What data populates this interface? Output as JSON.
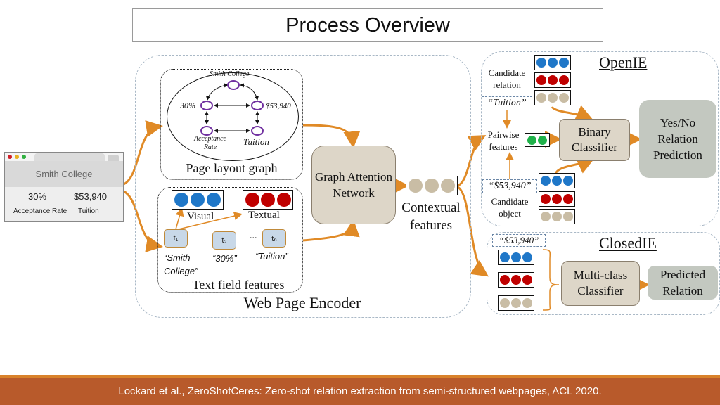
{
  "title": "Process Overview",
  "footer": "Lockard et al., ZeroShotCeres: Zero-shot relation extraction from semi-structured webpages, ACL 2020.",
  "colors": {
    "arrow": "#e08a26",
    "blue": "#1f77c8",
    "red": "#c00000",
    "beige": "#c9bda5",
    "green": "#1fb14a",
    "graph_node": "#7030a0",
    "footer_bg": "#b85a2b",
    "module_bg": "#ddd6c8",
    "output_bg": "#c3c8c0"
  },
  "webpage": {
    "title": "Smith College",
    "field1_value": "30%",
    "field1_label": "Acceptance Rate",
    "field2_value": "$53,940",
    "field2_label": "Tuition"
  },
  "encoder": {
    "label": "Web Page Encoder",
    "page_layout_graph": {
      "label": "Page layout graph",
      "nodes": {
        "top": "Smith College",
        "left": "30%",
        "right": "$53,940",
        "bottom_left": "Acceptance Rate",
        "bottom_right": "Tuition"
      }
    },
    "text_field_features": {
      "label": "Text field features",
      "visual_label": "Visual",
      "textual_label": "Textual",
      "tokens": [
        {
          "id": "t₁",
          "text": "“Smith College”"
        },
        {
          "id": "t₂",
          "text": "“30%”"
        },
        {
          "id": "tₙ",
          "text": "“Tuition”"
        }
      ],
      "ellipsis": "..."
    },
    "gat": "Graph Attention Network",
    "contextual_features": "Contextual features"
  },
  "openie": {
    "title": "OpenIE",
    "candidate_relation": "Candidate relation",
    "relation_quote": "“Tuition”",
    "pairwise_features": "Pairwise features",
    "object_quote": "“$53,940”",
    "candidate_object": "Candidate object",
    "classifier": "Binary Classifier",
    "output": "Yes/No Relation Prediction"
  },
  "closedie": {
    "title": "ClosedIE",
    "object_quote": "“$53,940”",
    "classifier": "Multi-class Classifier",
    "output": "Predicted Relation"
  }
}
